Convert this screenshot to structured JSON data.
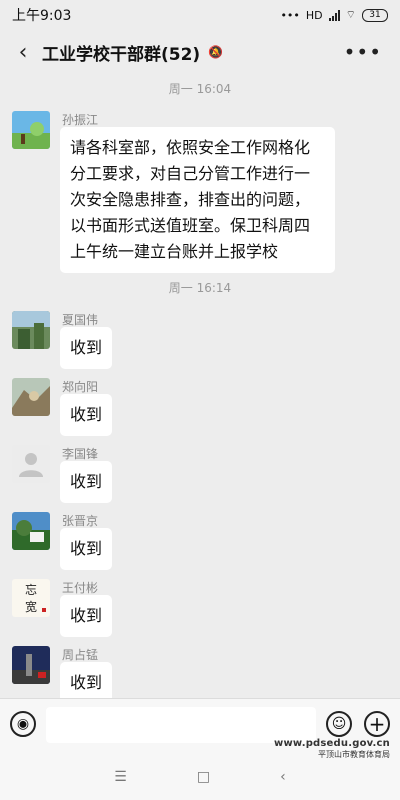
{
  "status": {
    "time": "上午9:03",
    "hd_label": "HD",
    "battery": "31"
  },
  "header": {
    "title": "工业学校干部群(52)"
  },
  "timestamps": {
    "t1": "周一 16:04",
    "t2": "周一 16:14"
  },
  "messages": [
    {
      "sender": "孙振江",
      "text": "请各科室部，依照安全工作网格化分工要求，对自己分管工作进行一次安全隐患排查，排查出的问题，以书面形式送值班室。保卫科周四上午统一建立台账并上报学校"
    },
    {
      "sender": "夏国伟",
      "text": "收到"
    },
    {
      "sender": "郑向阳",
      "text": "收到"
    },
    {
      "sender": "李国锋",
      "text": "收到"
    },
    {
      "sender": "张晋京",
      "text": "收到"
    },
    {
      "sender": "王付彬",
      "text": "收到"
    },
    {
      "sender": "周占锰",
      "text": "收到"
    }
  ],
  "avatar_art": {
    "wangfubin": "忘\n宽"
  },
  "watermark": {
    "line1": "www.pdsedu.gov.cn",
    "line2": "平顶山市教育体育局"
  }
}
